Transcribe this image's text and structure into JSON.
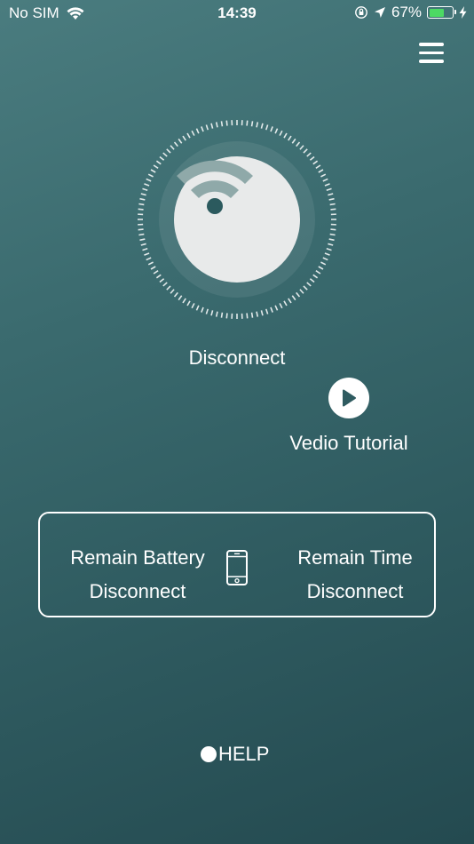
{
  "status_bar": {
    "carrier": "No SIM",
    "time": "14:39",
    "battery_percent": "67%",
    "battery_level": 0.67,
    "battery_color": "#4cd964"
  },
  "main": {
    "connection_status": "Disconnect",
    "video_tutorial_label": "Vedio Tutorial"
  },
  "info_card": {
    "battery_label": "Remain Battery",
    "battery_value": "Disconnect",
    "time_label": "Remain Time",
    "time_value": "Disconnect"
  },
  "footer": {
    "help_label": "HELP"
  },
  "icons": {
    "menu": "hamburger-menu-icon",
    "wifi": "wifi-icon",
    "play": "play-icon",
    "phone": "phone-icon"
  }
}
